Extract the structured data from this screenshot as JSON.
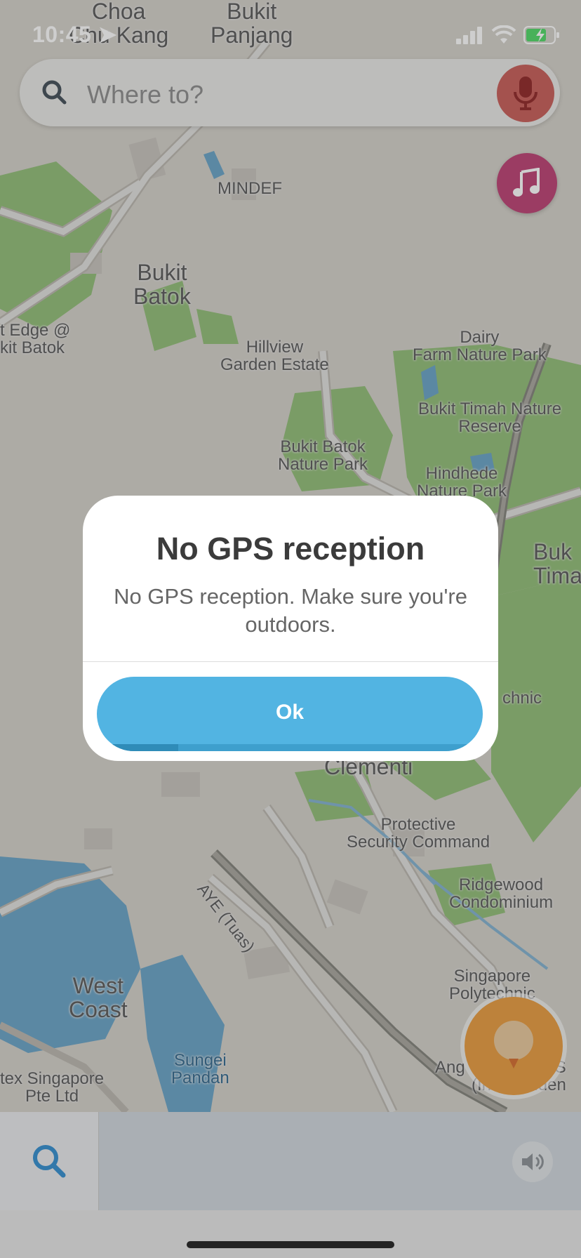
{
  "status_bar": {
    "time": "10:45"
  },
  "search": {
    "placeholder": "Where to?"
  },
  "map": {
    "labels": {
      "choa_chu_kang": "Choa\nChu Kang",
      "bukit_panjang": "Bukit\nPanjang",
      "mindef": "MINDEF",
      "bukit_batok": "Bukit\nBatok",
      "edge_bukit_batok": "t Edge @\nkit Batok",
      "hillview": "Hillview\nGarden Estate",
      "dairy_farm": "Dairy\nFarm Nature Park",
      "bukit_timah_reserve": "Bukit Timah Nature\nReserve",
      "bukit_batok_np": "Bukit Batok\nNature Park",
      "hindhede": "Hindhede\nNature Park",
      "bukit_timah": "Buk\nTima",
      "polytechnic_top": "chnic",
      "clementi": "Clementi",
      "protective": "Protective\nSecurity Command",
      "aye": "AYE (Tuas)",
      "ridgewood": "Ridgewood\nCondominium",
      "west_coast": "West\nCoast",
      "singapore_poly": "Singapore\nPolytechnic",
      "sungei_pandan": "Sungei\nPandan",
      "tex_singapore": "tex Singapore\nPte Ltd",
      "ang_mo": "Ang",
      "independence": "e S\n(Independen"
    }
  },
  "dialog": {
    "title": "No GPS reception",
    "message": "No GPS reception. Make sure you're outdoors.",
    "ok_label": "Ok",
    "ok_timer_progress": 0.21
  },
  "colors": {
    "accent": "#52b4e2",
    "mic": "#c75a55",
    "music": "#bb3c70",
    "recenter": "#e89a3b",
    "park": "#8fcf6d",
    "water": "#6fb3dc"
  }
}
